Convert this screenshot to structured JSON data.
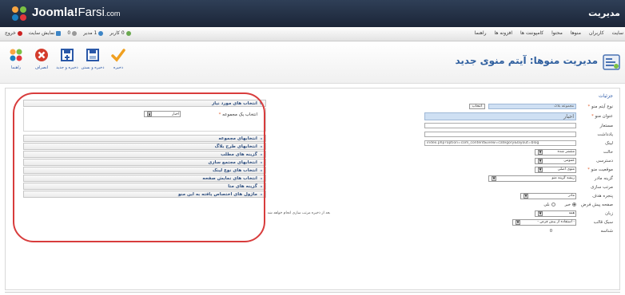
{
  "header": {
    "logo_text": "Joomla!",
    "logo_suffix": "Farsi",
    "logo_tld": ".com",
    "site_title": "مدیریت"
  },
  "statusbar": {
    "visitors": "0 کاربر",
    "admins": "1 مدیر",
    "messages": "0",
    "view_site": "نمایش سایت",
    "logout": "خروج"
  },
  "menu": [
    "سایت",
    "کاربران",
    "منوها",
    "محتوا",
    "کامپوننت ها",
    "افزونه ها",
    "راهنما"
  ],
  "toolbar": {
    "page_title": "مدیریت منوها: آیتم منوی جدید",
    "buttons": [
      {
        "label": "ذخیره",
        "icon": "save-check-icon"
      },
      {
        "label": "ذخیره و بستن",
        "icon": "save-close-icon"
      },
      {
        "label": "ذخیره و جدید",
        "icon": "save-new-icon"
      },
      {
        "label": "انصراف",
        "icon": "cancel-icon"
      },
      {
        "label": "راهنما",
        "icon": "help-icon"
      }
    ]
  },
  "details": {
    "legend": "جزئیات",
    "menu_item_type_label": "نوع آیتم منو",
    "menu_item_type_value": "مجموعه بلاگ",
    "select_button": "انتخاب",
    "title_label": "عنوان منو",
    "title_value": "اخبار",
    "alias_label": "مستعار",
    "note_label": "یادداشت",
    "link_label": "لینک",
    "link_value": "index.php?option=com_content&view=category&layout=blog",
    "status_label": "حالت",
    "status_value": "منتشر شده",
    "access_label": "دسترسی",
    "access_value": "عمومی",
    "menu_location_label": "موقعیت منو",
    "menu_location_value": "منوی اصلی",
    "parent_label": "گزینه مادر",
    "parent_value": "ریشه گزینه منو",
    "ordering_label": "مرتب سازی",
    "ordering_note": "بعد از ذخیره مرتب سازی انجام خواهد شد",
    "target_label": "پنجره هدف",
    "target_value": "مادر",
    "home_label": "صفحه پیش فرض",
    "home_yes": "بلی",
    "home_no": "خیر",
    "language_label": "زبان",
    "language_value": "همه",
    "style_label": "سبک قالب",
    "style_value": "- استفاده از پیش فرض -",
    "id_label": "شناسه",
    "id_value": "0"
  },
  "panels": {
    "required": {
      "title": "انتخاب های مورد نیاز",
      "choose_category_label": "انتخاب یک مجموعه",
      "choose_category_value": "اخبار"
    },
    "collapsed": [
      "انتخابهای مجموعه",
      "انتخابهای طرح بلاگ",
      "گزینه های مطلب",
      "انتخابهای مجتمع سازی",
      "انتخاب های نوع لینک",
      "انتخاب های نمایش صفحه",
      "گزینه های متا",
      "ماژول های اختصاص یافته به این منو"
    ]
  },
  "colors": {
    "header_bg": "#1b2537",
    "accent_blue": "#2a58a8",
    "highlight_ring": "#d83c3c"
  }
}
